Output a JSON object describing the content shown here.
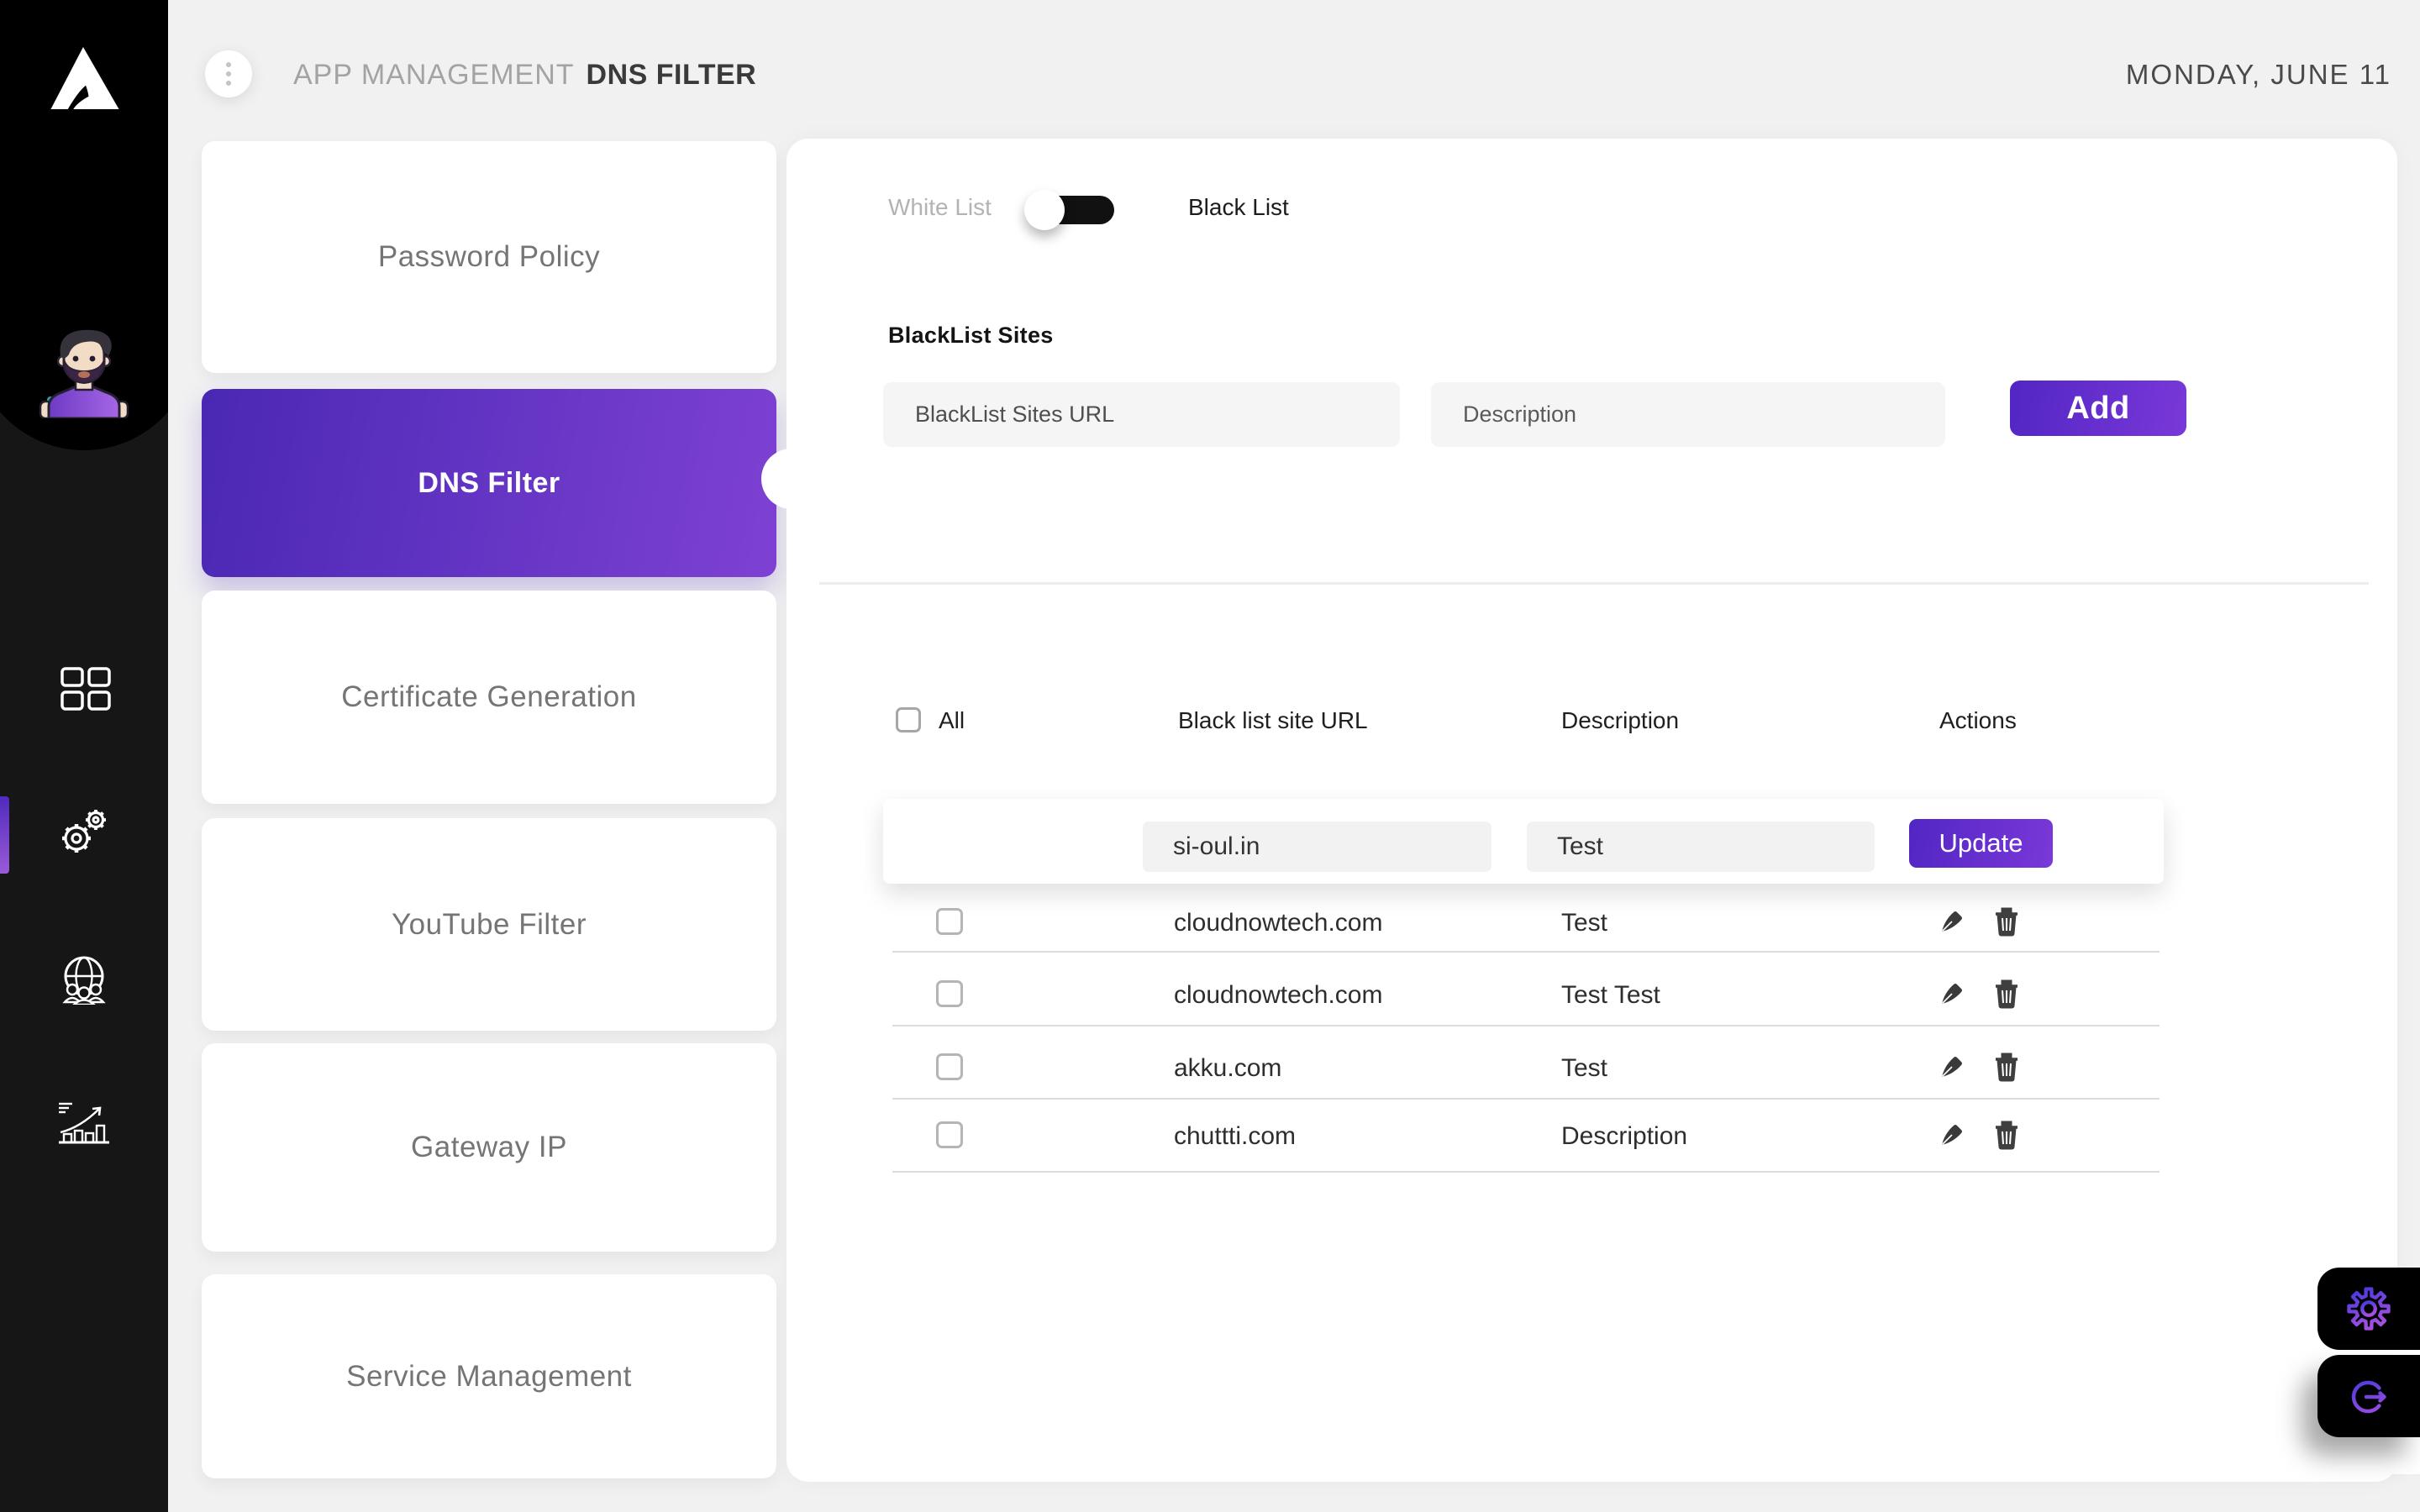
{
  "header": {
    "breadcrumb_section": "APP MANAGEMENT",
    "breadcrumb_page": "DNS FILTER",
    "date": "MONDAY, JUNE 11"
  },
  "sidebar": {
    "icons": [
      "app-grid",
      "settings-gears",
      "global-users",
      "analytics-chart"
    ],
    "active_item": "settings-gears"
  },
  "menu": {
    "items": [
      {
        "label": "Password Policy",
        "active": false
      },
      {
        "label": "DNS Filter",
        "active": true
      },
      {
        "label": "Certificate Generation",
        "active": false
      },
      {
        "label": "YouTube Filter",
        "active": false
      },
      {
        "label": "Gateway IP",
        "active": false
      },
      {
        "label": "Service Management",
        "active": false
      }
    ]
  },
  "content": {
    "toggle": {
      "left_label": "White List",
      "right_label": "Black List",
      "selected": "Black List"
    },
    "form": {
      "section_label": "BlackList Sites",
      "url_placeholder": "BlackList Sites URL",
      "desc_placeholder": "Description",
      "add_label": "Add"
    },
    "table": {
      "select_all_label": "All",
      "columns": [
        "Black list site URL",
        "Description",
        "Actions"
      ],
      "edit_row": {
        "url": "si-oul.in",
        "description": "Test",
        "button_label": "Update"
      },
      "rows": [
        {
          "url": "cloudnowtech.com",
          "description": "Test"
        },
        {
          "url": "cloudnowtech.com",
          "description": "Test Test"
        },
        {
          "url": "akku.com",
          "description": "Test"
        },
        {
          "url": "chuttti.com",
          "description": "Description"
        }
      ]
    }
  },
  "colors": {
    "accent_start": "#4a28b4",
    "accent_end": "#7e41d3",
    "sidebar_bg": "#161616",
    "page_bg": "#f1f1f2"
  }
}
